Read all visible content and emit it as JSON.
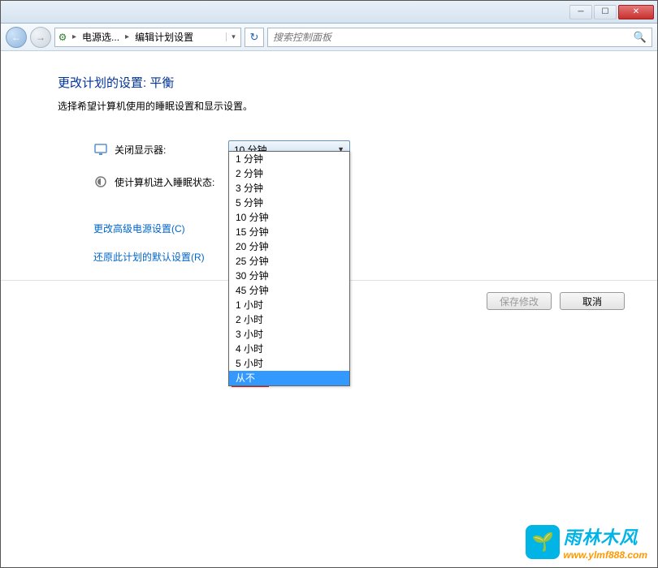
{
  "titlebar": {
    "min": "─",
    "max": "☐",
    "close": "✕"
  },
  "nav": {
    "back": "←",
    "fwd": "→",
    "crumb1": "电源选...",
    "crumb2": "编辑计划设置",
    "refresh": "↻",
    "search_placeholder": "搜索控制面板",
    "search_icon": "🔍"
  },
  "page": {
    "heading": "更改计划的设置: 平衡",
    "subtext": "选择希望计算机使用的睡眠设置和显示设置。",
    "display_label": "关闭显示器:",
    "display_value": "10 分钟",
    "sleep_label": "使计算机进入睡眠状态:",
    "link_advanced": "更改高级电源设置(C)",
    "link_restore": "还原此计划的默认设置(R)",
    "save": "保存修改",
    "cancel": "取消"
  },
  "dropdown": {
    "items": [
      "1 分钟",
      "2 分钟",
      "3 分钟",
      "5 分钟",
      "10 分钟",
      "15 分钟",
      "20 分钟",
      "25 分钟",
      "30 分钟",
      "45 分钟",
      "1 小时",
      "2 小时",
      "3 小时",
      "4 小时",
      "5 小时",
      "从不"
    ],
    "highlighted": "从不"
  },
  "watermark": {
    "cn": "雨林木风",
    "url": "www.ylmf888.com",
    "leaf": "🌱"
  }
}
